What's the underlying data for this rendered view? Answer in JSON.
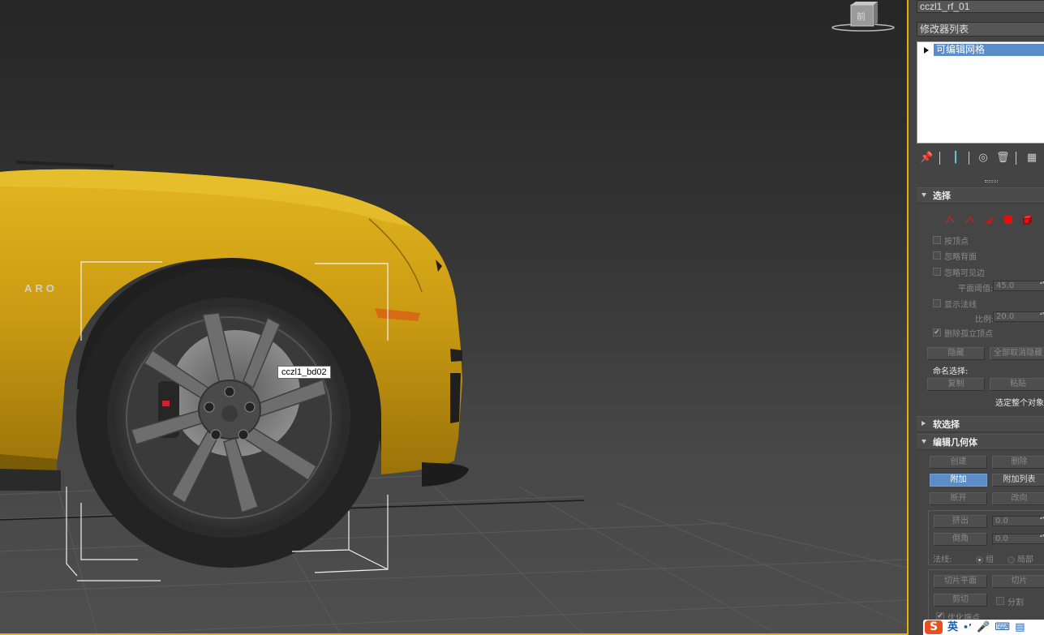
{
  "viewport": {
    "object_tooltip": "cczl1_bd02",
    "viewcube_label": "前",
    "car_badge_text": "ARO"
  },
  "panel": {
    "object_name": "cczl1_rf_01",
    "modifier_list": "修改器列表",
    "stack_items": [
      "可编辑网格"
    ],
    "selection": {
      "title": "选择",
      "by_vertex": "按顶点",
      "ignore_backfacing": "忽略背面",
      "ignore_visible_edges": "忽略可见边",
      "planar_threshold_label": "平面阈值:",
      "planar_threshold_value": "45.0",
      "show_normals": "显示法线",
      "scale_label": "比例:",
      "scale_value": "20.0",
      "delete_isolated_vertices": "删除孤立顶点",
      "hide_button": "隐藏",
      "unhide_all_button": "全部取消隐藏",
      "named_selections_label": "命名选择:",
      "copy_button": "复制",
      "paste_button": "粘贴",
      "select_whole_object": "选定整个对象"
    },
    "soft_selection": {
      "title": "软选择"
    },
    "edit_geometry": {
      "title": "编辑几何体",
      "create_button": "创建",
      "delete_button": "删除",
      "attach_button": "附加",
      "attach_list_button": "附加列表",
      "detach_button": "断开",
      "turn_button": "改向",
      "extrude_button": "挤出",
      "extrude_value": "0.0",
      "chamfer_button": "倒角",
      "chamfer_value": "0.0",
      "normal_label": "法线:",
      "group_label": "组",
      "local_label": "局部",
      "slice_plane_button": "切片平面",
      "slice_button": "切片",
      "cut_button": "剪切",
      "split_label": "分割",
      "refine_ends_label": "优化端点"
    }
  },
  "taskbar": {
    "ime_logo": "S",
    "ime_mode": "英"
  },
  "colors": {
    "car_body": "#d4a514",
    "selection_highlight": "#5b8dc9",
    "viewport_border": "#e0b400",
    "subobject_red": "#e01010"
  }
}
